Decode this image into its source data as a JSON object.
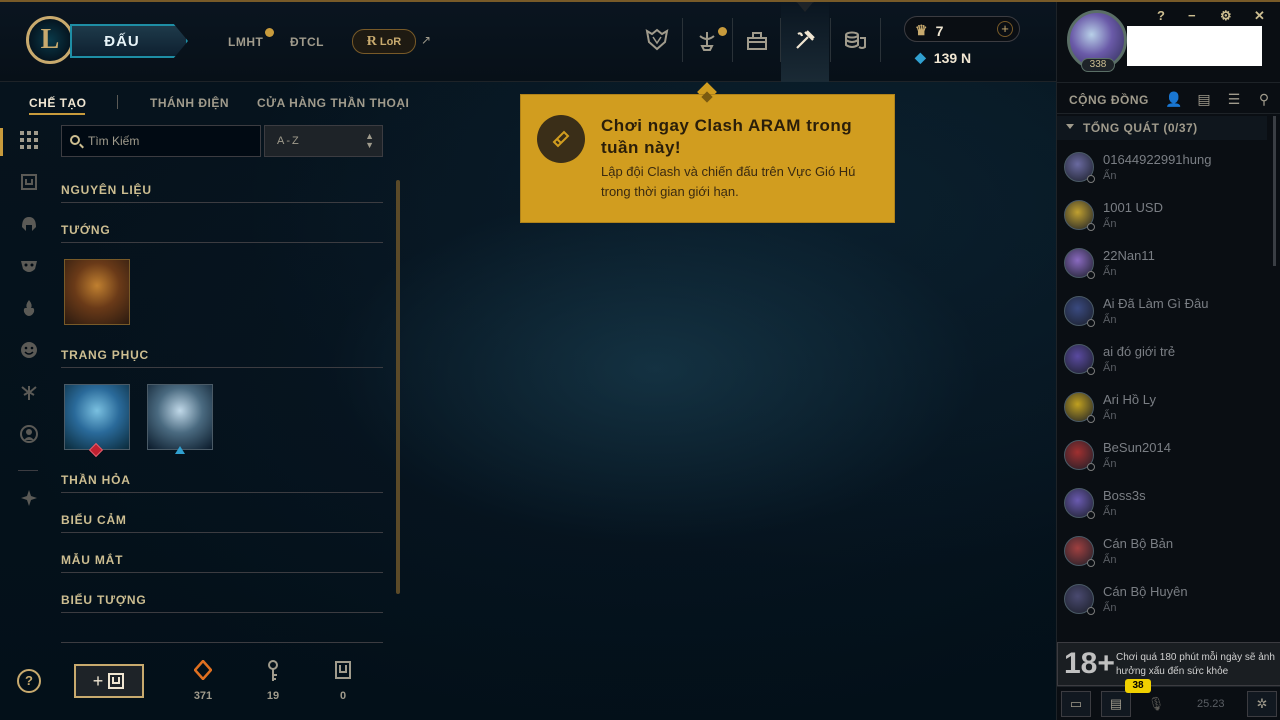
{
  "topbar": {
    "play_label": "ĐẤU",
    "links": [
      "LMHT",
      "ĐTCL"
    ],
    "lor_label": "LoR",
    "logo_letter": "L"
  },
  "currency": {
    "rp": "7",
    "be": "139 N"
  },
  "profile": {
    "level": "338"
  },
  "window_controls": [
    "?",
    "−",
    "⚙",
    "✕"
  ],
  "subnav": {
    "tabs": [
      "CHẾ TẠO",
      "THÁNH ĐIỆN",
      "CỬA HÀNG THẦN THOẠI"
    ]
  },
  "search": {
    "placeholder": "Tìm Kiếm",
    "sort_value": "A-Z"
  },
  "categories": {
    "materials": "NGUYÊN LIỆU",
    "champions": "TƯỚNG",
    "skins": "TRANG PHỤC",
    "wards": "THẦN HỎA",
    "emotes": "BIỂU CẢM",
    "eyes": "MẪU MẮT",
    "icons": "BIỂU TƯỢNG"
  },
  "bottom_stats": {
    "essence": "371",
    "keys": "19",
    "chests": "0"
  },
  "popup": {
    "title": "Chơi ngay Clash ARAM trong tuần này!",
    "body": "Lập đội Clash và chiến đấu trên Vực Gió Hú trong thời gian giới hạn."
  },
  "community": {
    "label": "CỘNG ĐỒNG",
    "group_label": "TỔNG QUÁT (0/37)",
    "friends": [
      {
        "name": "01644922991hung",
        "status": "Ẩn",
        "color": "#6a6aa0"
      },
      {
        "name": "1001 USD",
        "status": "Ẩn",
        "color": "#c0a030"
      },
      {
        "name": "22Nan11",
        "status": "Ẩn",
        "color": "#8a6ac0"
      },
      {
        "name": "Ai Đã Làm Gì Đâu",
        "status": "Ẩn",
        "color": "#3a4a80"
      },
      {
        "name": "ai đó giới trẻ",
        "status": "Ẩn",
        "color": "#5a4aa0"
      },
      {
        "name": "Ari Hồ Ly",
        "status": "Ẩn",
        "color": "#c0a020"
      },
      {
        "name": "BeSun2014",
        "status": "Ẩn",
        "color": "#a03030"
      },
      {
        "name": "Boss3s",
        "status": "Ẩn",
        "color": "#6a5ab0"
      },
      {
        "name": "Cán Bộ Bản",
        "status": "Ẩn",
        "color": "#a04040"
      },
      {
        "name": "Cán Bộ Huyên",
        "status": "Ẩn",
        "color": "#4a4a70"
      }
    ]
  },
  "age_warning": {
    "rating": "18+",
    "text": "Chơi quá 180 phút mỗi ngày sẽ ảnh hưởng xấu đến sức khỏe"
  },
  "bottom_bar": {
    "chat_badge": "38",
    "version": "25.23"
  }
}
